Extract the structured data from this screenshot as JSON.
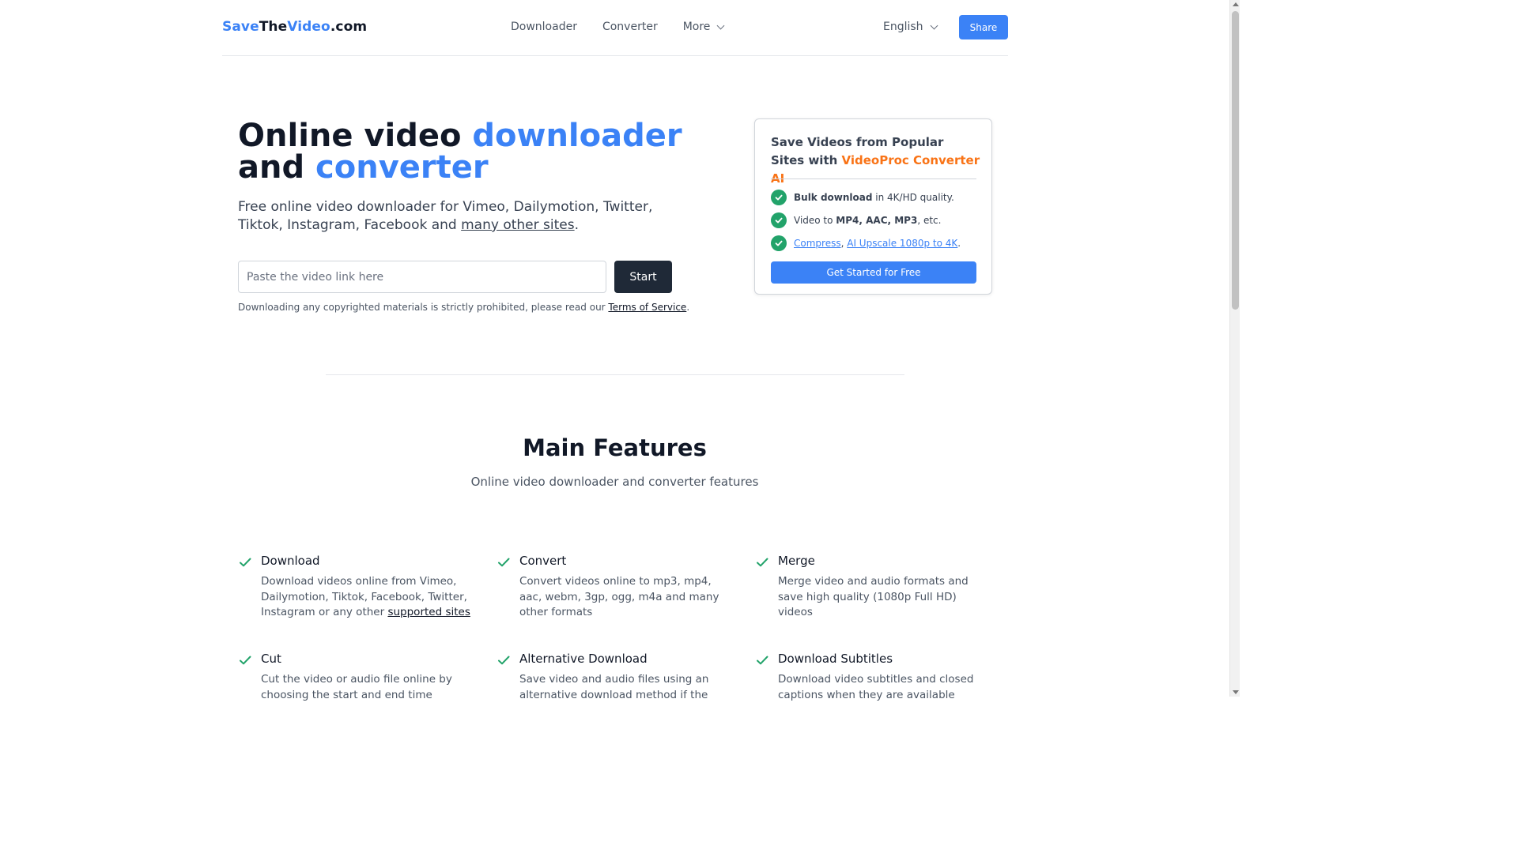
{
  "header": {
    "logo_part1": "Save",
    "logo_part2": "The",
    "logo_part3": "Video",
    "logo_part4": ".com",
    "nav": [
      "Downloader",
      "Converter",
      "More"
    ],
    "language": "English",
    "share_label": "Share"
  },
  "hero": {
    "title_part1": "Online video ",
    "title_part2": "downloader",
    "title_part3": "and ",
    "title_part4": "converter",
    "subtitle_text": "Free online video downloader for Vimeo, Dailymotion, Twitter, Tiktok, Instagram, Facebook and ",
    "subtitle_link": "many other sites",
    "subtitle_end": ".",
    "input_placeholder": "Paste the video link here",
    "start_label": "Start",
    "disclaimer_text": "Downloading any copyrighted materials is strictly prohibited, please read our ",
    "disclaimer_link": "Terms of Service",
    "disclaimer_end": "."
  },
  "promo": {
    "title_text": "Save Videos from Popular Sites with ",
    "title_highlight": "VideoProc Converter AI",
    "row1_bold": "Bulk download",
    "row1_text": " in 4K/HD quality.",
    "row2_text": "Video to ",
    "row2_bold": "MP4, AAC, MP3",
    "row2_end": ", etc.",
    "row3_link1": "Compress",
    "row3_sep": ", ",
    "row3_link2": "AI Upscale 1080p to 4K",
    "row3_end": ".",
    "button_label": "Get Started for Free",
    "accent": "#f97316",
    "check_color": "#22a36a"
  },
  "features": {
    "title": "Main Features",
    "subtitle": "Online video downloader and converter features",
    "items": [
      {
        "name": "Download",
        "desc": "Download videos online from Vimeo, Dailymotion, Tiktok, Facebook, Twitter, Instagram or any other ",
        "link": "supported sites"
      },
      {
        "name": "Convert",
        "desc": "Convert videos online to mp3, mp4, aac, webm, 3gp, ogg, m4a and many other formats",
        "link": ""
      },
      {
        "name": "Merge",
        "desc": "Merge video and audio formats and save high quality (1080p Full HD) videos",
        "link": ""
      },
      {
        "name": "Cut",
        "desc": "Cut the video or audio file online by choosing the start and end time",
        "link": ""
      },
      {
        "name": "Alternative Download",
        "desc": "Save video and audio files using an alternative download method if the",
        "link": ""
      },
      {
        "name": "Download Subtitles",
        "desc": "Download video subtitles and closed captions when they are available",
        "link": ""
      }
    ],
    "check_color": "#22a36a"
  },
  "colors": {
    "brand_blue": "#3b82f6",
    "dark_button": "#1f2937"
  }
}
